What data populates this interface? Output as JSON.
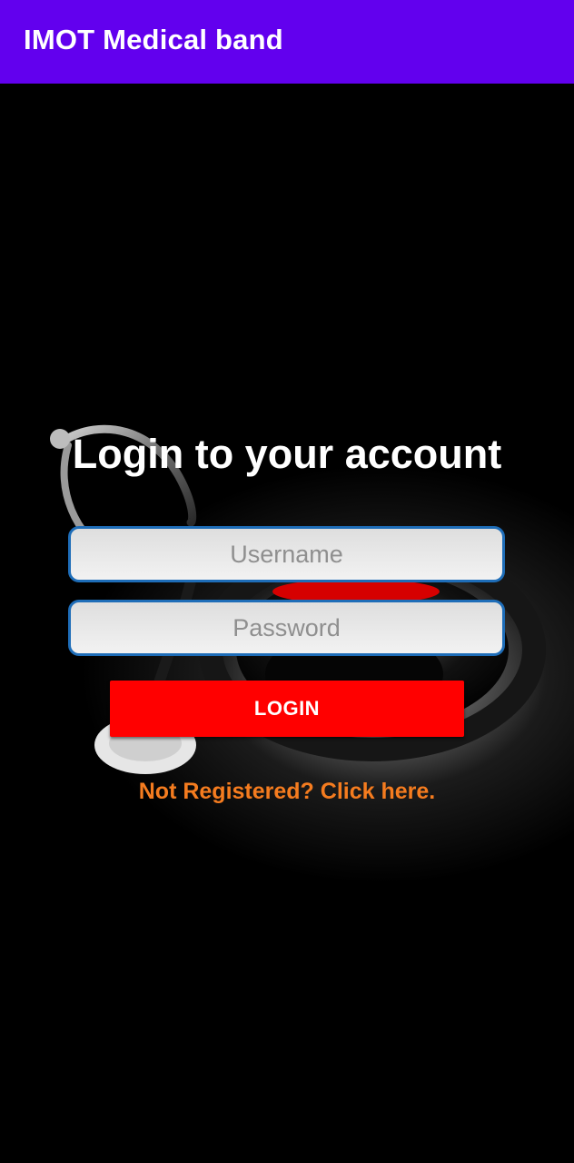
{
  "app_bar": {
    "title": "IMOT Medical band",
    "color": "#6200ee"
  },
  "background": {
    "image": "stethoscope-image"
  },
  "login": {
    "heading": "Login to your account",
    "username_placeholder": "Username",
    "password_placeholder": "Password",
    "login_button_label": "LOGIN",
    "register_link_text": "Not Registered? Click here."
  },
  "colors": {
    "button": "#ff0000",
    "link": "#f57c1f",
    "field_border": "#1e6db8"
  }
}
